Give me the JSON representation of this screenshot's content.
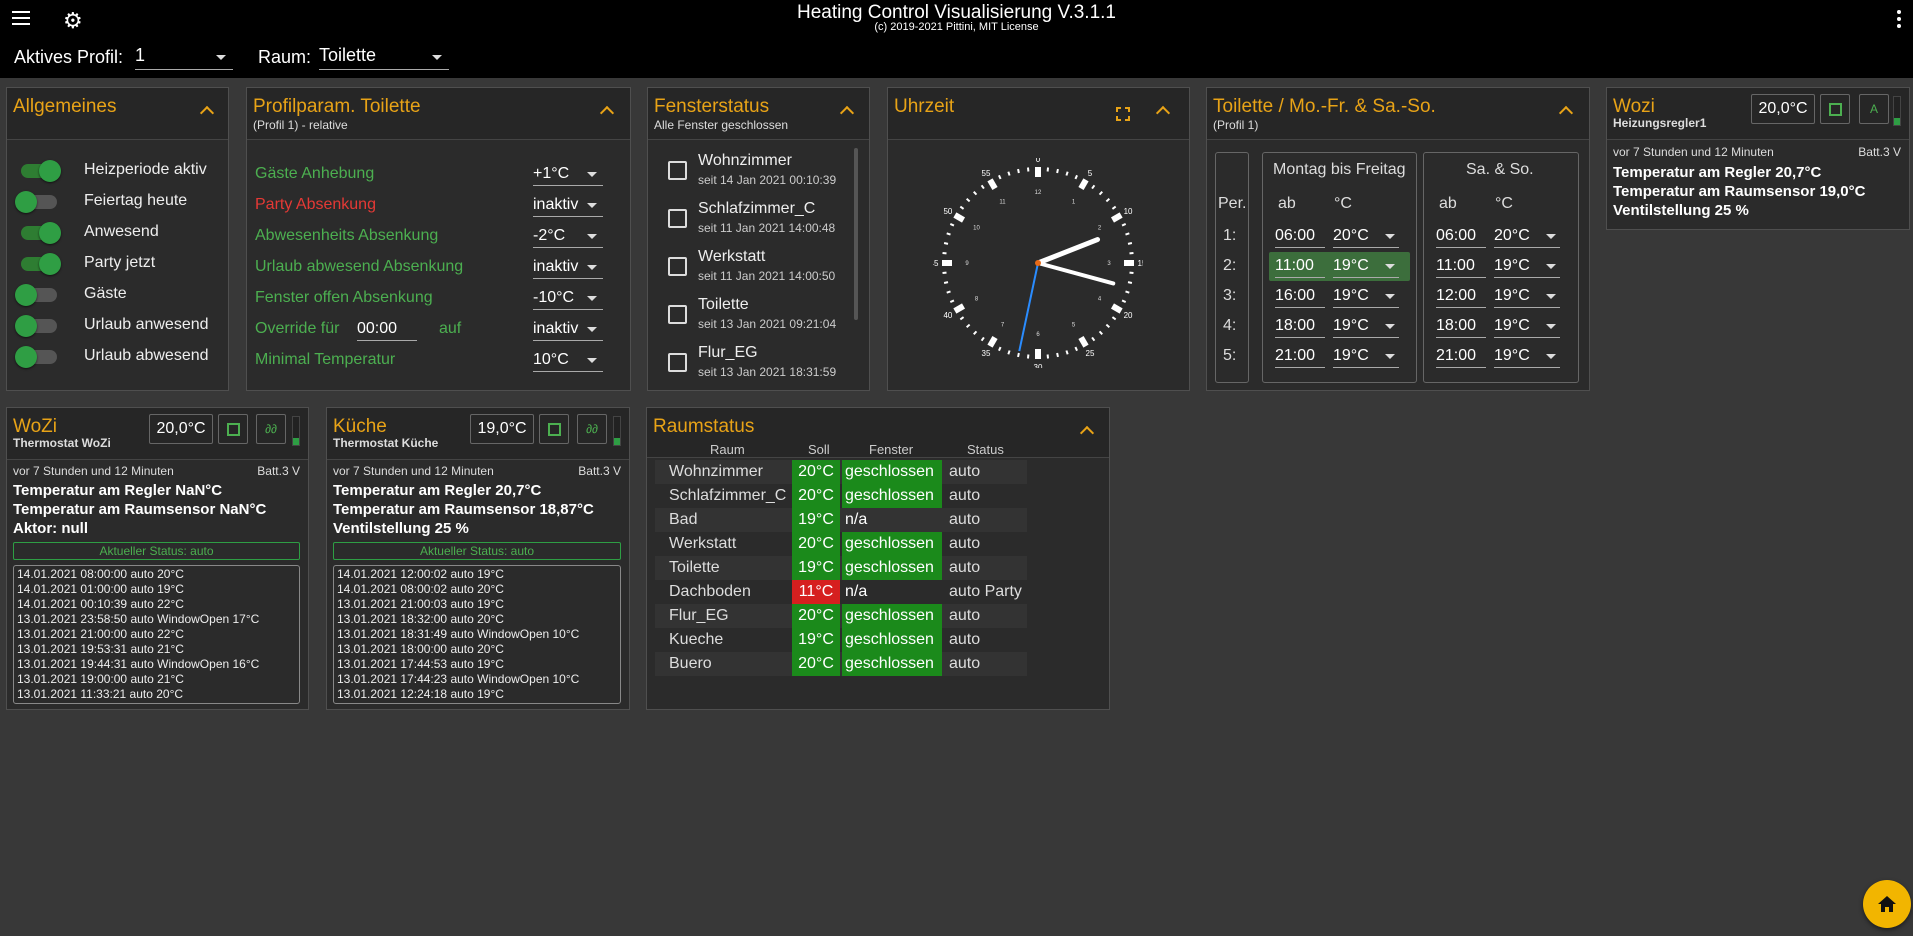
{
  "header": {
    "title": "Heating Control Visualisierung V.3.1.1",
    "subtitle": "(c) 2019-2021 Pittini, MIT License",
    "profile_label": "Aktives Profil:",
    "profile_value": "1",
    "room_label": "Raum:",
    "room_value": "Toilette"
  },
  "allgemeines": {
    "title": "Allgemeines",
    "switches": [
      {
        "label": "Heizperiode aktiv",
        "on": true
      },
      {
        "label": "Feiertag heute",
        "on": false
      },
      {
        "label": "Anwesend",
        "on": true
      },
      {
        "label": "Party jetzt",
        "on": true
      },
      {
        "label": "Gäste",
        "on": false
      },
      {
        "label": "Urlaub anwesend",
        "on": false
      },
      {
        "label": "Urlaub abwesend",
        "on": false
      }
    ]
  },
  "profilparam": {
    "title": "Profilparam. Toilette",
    "subtitle": "(Profil 1) - relative",
    "rows": [
      {
        "label": "Gäste Anhebung",
        "value": "+1°C"
      },
      {
        "label": "Party Absenkung",
        "value": "inaktiv"
      },
      {
        "label": "Abwesenheits Absenkung",
        "value": "-2°C"
      },
      {
        "label": "Urlaub abwesend Absenkung",
        "value": "inaktiv"
      },
      {
        "label": "Fenster offen Absenkung",
        "value": "-10°C"
      },
      {
        "label": "Override für",
        "value": "inaktiv",
        "time": "00:00",
        "mid": "auf"
      },
      {
        "label": "Minimal Temperatur",
        "value": "10°C"
      }
    ]
  },
  "fensterstatus": {
    "title": "Fensterstatus",
    "subtitle": "Alle Fenster geschlossen",
    "windows": [
      {
        "name": "Wohnzimmer",
        "time": "seit 14 Jan 2021 00:10:39"
      },
      {
        "name": "Schlafzimmer_C",
        "time": "seit 11 Jan 2021 14:00:48"
      },
      {
        "name": "Werkstatt",
        "time": "seit 11 Jan 2021 14:00:50"
      },
      {
        "name": "Toilette",
        "time": "seit 13 Jan 2021 09:21:04"
      },
      {
        "name": "Flur_EG",
        "time": "seit 13 Jan 2021 18:31:59"
      }
    ]
  },
  "uhrzeit": {
    "title": "Uhrzeit",
    "hour_labels": [
      "0",
      "5",
      "10",
      "15",
      "20",
      "25",
      "30",
      "35",
      "40",
      "45",
      "50",
      "55"
    ],
    "sub_labels": [
      "1",
      "2",
      "3",
      "4",
      "5",
      "6",
      "7",
      "8",
      "9",
      "10",
      "11",
      "12"
    ],
    "time": {
      "h": 2,
      "m": 17,
      "s": 32
    }
  },
  "zeitplan": {
    "title": "Toilette / Mo.-Fr. & Sa.-So.",
    "subtitle": "(Profil 1)",
    "per_label": "Per.",
    "weekday_title": "Montag bis Freitag",
    "weekend_title": "Sa. & So.",
    "col_ab": "ab",
    "col_c": "°C",
    "periods": [
      "1:",
      "2:",
      "3:",
      "4:",
      "5:"
    ],
    "weekday": [
      {
        "time": "06:00",
        "temp": "20°C"
      },
      {
        "time": "11:00",
        "temp": "19°C"
      },
      {
        "time": "16:00",
        "temp": "19°C"
      },
      {
        "time": "18:00",
        "temp": "19°C"
      },
      {
        "time": "21:00",
        "temp": "19°C"
      }
    ],
    "weekend": [
      {
        "time": "06:00",
        "temp": "20°C"
      },
      {
        "time": "11:00",
        "temp": "19°C"
      },
      {
        "time": "12:00",
        "temp": "19°C"
      },
      {
        "time": "18:00",
        "temp": "19°C"
      },
      {
        "time": "21:00",
        "temp": "19°C"
      }
    ],
    "active_index": 1
  },
  "wozi_regler": {
    "title": "Wozi",
    "subtitle": "Heizungsregler1",
    "setpoint": "20,0°C",
    "btn_a": "A",
    "last_update": "vor 7 Stunden und 12 Minuten",
    "battery": "Batt.3 V",
    "lines": [
      "Temperatur am Regler 20,7°C",
      "Temperatur am Raumsensor 19,0°C",
      "Ventilstellung 25 %"
    ],
    "signal_level": 0.25
  },
  "thermostat_wozi": {
    "title": "WoZi",
    "subtitle": "Thermostat WoZi",
    "setpoint": "20,0°C",
    "last_update": "vor 7 Stunden und 12 Minuten",
    "battery": "Batt.3 V",
    "lines": [
      "Temperatur am Regler NaN°C",
      "Temperatur am Raumsensor NaN°C",
      "Aktor: null"
    ],
    "status": "Aktueller Status: auto",
    "signal_level": 0.25,
    "log": [
      "14.01.2021 08:00:00 auto 20°C",
      "14.01.2021 01:00:00 auto 19°C",
      "14.01.2021 00:10:39 auto 22°C",
      "13.01.2021 23:58:50 auto WindowOpen 17°C",
      "13.01.2021 21:00:00 auto 22°C",
      "13.01.2021 19:53:31 auto 21°C",
      "13.01.2021 19:44:31 auto WindowOpen 16°C",
      "13.01.2021 19:00:00 auto 21°C",
      "13.01.2021 11:33:21 auto 20°C"
    ]
  },
  "thermostat_kueche": {
    "title": "Küche",
    "subtitle": "Thermostat Küche",
    "setpoint": "19,0°C",
    "last_update": "vor 7 Stunden und 12 Minuten",
    "battery": "Batt.3 V",
    "lines": [
      "Temperatur am Regler 20,7°C",
      "Temperatur am Raumsensor 18,87°C",
      "Ventilstellung 25 %"
    ],
    "status": "Aktueller Status: auto",
    "signal_level": 0.25,
    "log": [
      "14.01.2021 12:00:02 auto 19°C",
      "14.01.2021 08:00:02 auto 20°C",
      "13.01.2021 21:00:03 auto 19°C",
      "13.01.2021 18:32:00 auto 20°C",
      "13.01.2021 18:31:49 auto WindowOpen 10°C",
      "13.01.2021 18:00:00 auto 20°C",
      "13.01.2021 17:44:53 auto 19°C",
      "13.01.2021 17:44:23 auto WindowOpen 10°C",
      "13.01.2021 12:24:18 auto 19°C"
    ]
  },
  "raumstatus": {
    "title": "Raumstatus",
    "headers": [
      "Raum",
      "Soll",
      "Fenster",
      "Status"
    ],
    "rows": [
      {
        "raum": "Wohnzimmer",
        "soll": "20°C",
        "fenster": "geschlossen",
        "status": "auto",
        "alert": false,
        "fen_ok": true
      },
      {
        "raum": "Schlafzimmer_C",
        "soll": "20°C",
        "fenster": "geschlossen",
        "status": "auto",
        "alert": false,
        "fen_ok": true
      },
      {
        "raum": "Bad",
        "soll": "19°C",
        "fenster": "n/a",
        "status": "auto",
        "alert": false,
        "fen_ok": false
      },
      {
        "raum": "Werkstatt",
        "soll": "20°C",
        "fenster": "geschlossen",
        "status": "auto",
        "alert": false,
        "fen_ok": true
      },
      {
        "raum": "Toilette",
        "soll": "19°C",
        "fenster": "geschlossen",
        "status": "auto",
        "alert": false,
        "fen_ok": true
      },
      {
        "raum": "Dachboden",
        "soll": "11°C",
        "fenster": "n/a",
        "status": "auto Party",
        "alert": true,
        "fen_ok": false
      },
      {
        "raum": "Flur_EG",
        "soll": "20°C",
        "fenster": "geschlossen",
        "status": "auto",
        "alert": false,
        "fen_ok": true
      },
      {
        "raum": "Kueche",
        "soll": "19°C",
        "fenster": "geschlossen",
        "status": "auto",
        "alert": false,
        "fen_ok": true
      },
      {
        "raum": "Buero",
        "soll": "20°C",
        "fenster": "geschlossen",
        "status": "auto",
        "alert": false,
        "fen_ok": true
      }
    ]
  },
  "icons": {
    "menu": "menu-icon",
    "settings": "gear-icon",
    "more": "more-vert-icon",
    "collapse": "chevron-up-icon",
    "fullscreen": "fullscreen-icon",
    "home": "home-icon"
  },
  "colors": {
    "accent": "#e8a317",
    "ok": "#1b8a1b",
    "alert": "#d61f1f",
    "active_row": "#3c6e3c"
  }
}
